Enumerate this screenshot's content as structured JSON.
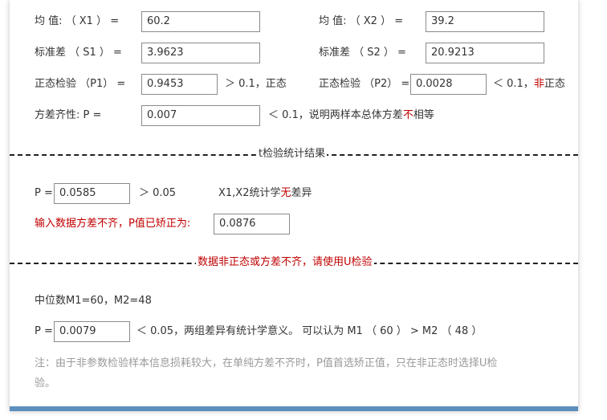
{
  "stats": {
    "mean1_label": "均 值: （ X1 ） =",
    "mean1_value": "60.2",
    "mean2_label": "均 值: （ X2 ） =",
    "mean2_value": "39.2",
    "sd1_label": "标准差 （ S1 ） =",
    "sd1_value": "3.9623",
    "sd2_label": "标准差 （ S2 ） =",
    "sd2_value": "20.9213",
    "norm1_label": "正态检验 （P1） =",
    "norm1_value": "0.9453",
    "norm1_result": "＞ 0.1，正态",
    "norm2_label": "正态检验 （P2） =",
    "norm2_value": "0.0028",
    "norm2_result_prefix": "＜ 0.1，",
    "norm2_result_red": "非",
    "norm2_result_suffix": "正态",
    "var_label": "方差齐性: P =",
    "var_value": "0.007",
    "var_result_prefix": "＜ 0.1，说明两样本总体方差",
    "var_result_red": "不",
    "var_result_suffix": "相等"
  },
  "ttest": {
    "title": "t检验统计结果",
    "p_label": "P =",
    "p_value": "0.0585",
    "p_compare": "＞  0.05",
    "conclusion_prefix": "X1,X2统计学",
    "conclusion_red": "无",
    "conclusion_suffix": "差异",
    "corrected_label": "输入数据方差不齐，P值已矫正为:",
    "corrected_value": "0.0876"
  },
  "utest": {
    "title": "数据非正态或方差不齐，请使用U检验",
    "medians": "中位数M1=60，M2=48",
    "p_label": "P =",
    "p_value": "0.0079",
    "p_result": "＜ 0.05，两组差异有统计学意义。 可以认为 M1 （ 60 ） > M2 （ 48 ）",
    "note_line1": "注：由于非参数检验样本信息损耗较大，在单纯方差不齐时，P值首选矫正值，只在非正态时选择U检",
    "note_line2": "验。"
  },
  "colors": {
    "accent_red": "#c00000",
    "note_gray": "#9a9a9a",
    "bottom_bar": "#5b8fbe"
  }
}
